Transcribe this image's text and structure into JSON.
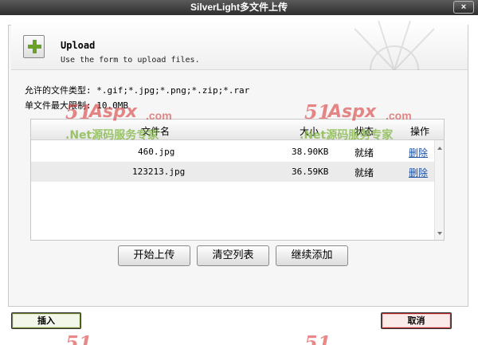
{
  "window": {
    "title": "SilverLight多文件上传",
    "close_label": "×"
  },
  "header": {
    "title": "Upload",
    "subtitle": "Use the form to upload files."
  },
  "info": {
    "allowed_types": "允许的文件类型: *.gif;*.jpg;*.png;*.zip;*.rar",
    "max_size": "单文件最大限制: 10.0MB"
  },
  "table": {
    "columns": [
      "文件名",
      "大小",
      "状态",
      "操作"
    ],
    "rows": [
      {
        "name": "460.jpg",
        "size": "38.90KB",
        "status": "就绪",
        "action": "删除"
      },
      {
        "name": "123213.jpg",
        "size": "36.59KB",
        "status": "就绪",
        "action": "删除"
      }
    ]
  },
  "buttons": {
    "start": "开始上传",
    "clear": "清空列表",
    "add_more": "继续添加",
    "insert": "插入",
    "cancel": "取消"
  },
  "watermark": {
    "brand_num": "51",
    "brand_word": "Aspx",
    "brand_com": ".com",
    "tagline": ".Net源码服务专家"
  },
  "colors": {
    "titlebar": "#3a3a3a",
    "link": "#1a4fa3",
    "insert_border": "#6a7f2e",
    "cancel_border": "#b3262a"
  }
}
